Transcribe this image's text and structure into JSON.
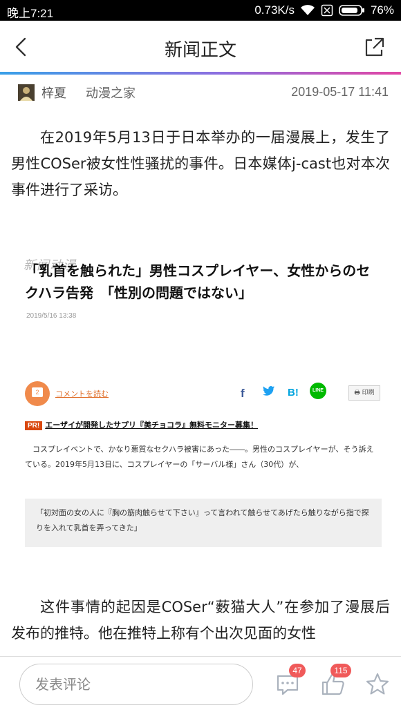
{
  "status_bar": {
    "time": "晚上7:21",
    "net_speed": "0.73K/s",
    "battery": "76%"
  },
  "header": {
    "title": "新闻正文",
    "accent_colors": [
      "#3aa0e8",
      "#8d6fe0",
      "#e246a4"
    ]
  },
  "meta": {
    "author": "梓夏",
    "source": "动漫之家",
    "date": "2019-05-17 11:41"
  },
  "article": {
    "paragraph1": "在2019年5月13日于日本举办的一届漫展上，发生了男性COSer被女性性骚扰的事件。日本媒体j-cast也对本次事件进行了采访。",
    "paragraph2": "这件事情的起因是COSer“薮猫大人”在参加了漫展后发布的推特。他在推特上称有个出次见面的女性"
  },
  "embed": {
    "watermark": "新闻动漫",
    "headline": "「乳首を触られた」男性コスプレイヤー、女性からのセクハラ告発　「性別の問題ではない」",
    "date": "2019/5/16 13:38",
    "comment_count": "2",
    "comment_link": "コメントを読む",
    "share_icons": [
      "facebook-icon",
      "twitter-icon",
      "hatena-bookmark-icon",
      "line-icon"
    ],
    "sns": {
      "facebook": "f",
      "hatena": "B!",
      "line": "LINE"
    },
    "print_label": "印刷",
    "pr_badge": "PR!",
    "pr_text": "エーザイが開発したサプリ『美チョコラ』無料モニター募集！",
    "body": "コスプレイベントで、かなり悪質なセクハラ被害にあった――。男性のコスプレイヤーが、そう訴えている。2019年5月13日に、コスプレイヤーの「サーバル様」さん（30代）が、",
    "quote": "「初対面の女の人に『胸の筋肉触らせて下さい』って言われて触らせてあげたら触りながら指で探りを入れて乳首を弄ってきた」"
  },
  "bottom_bar": {
    "comment_placeholder": "发表评论",
    "comments_count": "47",
    "likes_count": "115",
    "badge_color": "#f05a5a"
  }
}
